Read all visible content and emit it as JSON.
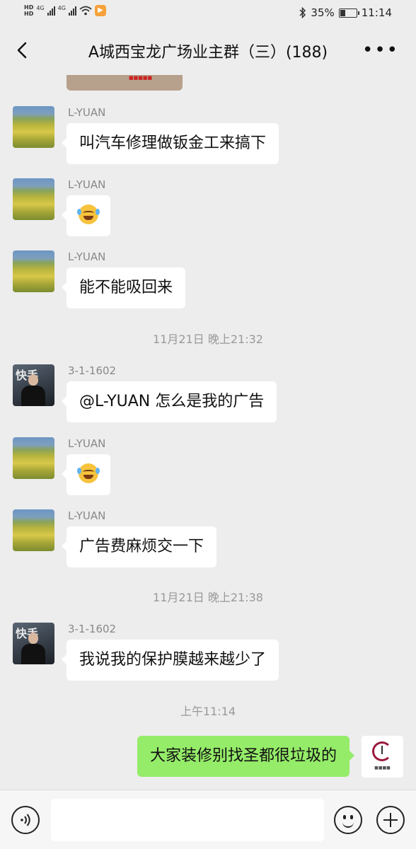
{
  "status_bar": {
    "hd1": "HD",
    "hd2": "HD",
    "net1": "4G",
    "net2": "4G",
    "battery_text": "35%",
    "battery_level": 0.35,
    "time": "11:14"
  },
  "nav": {
    "title": "A城西宝龙广场业主群（三）(188)",
    "more_icon": "more-icon",
    "back_icon": "back-icon"
  },
  "messages": [
    {
      "sender": "L-YUAN",
      "text": "叫汽车修理做钣金工来搞下"
    },
    {
      "sender": "L-YUAN",
      "emoji": "crying-laughing-emoji"
    },
    {
      "sender": "L-YUAN",
      "text": "能不能吸回来"
    },
    {
      "sender": "3-1-1602",
      "text": "@L-YUAN  怎么是我的广告"
    },
    {
      "sender": "L-YUAN",
      "emoji": "crying-laughing-emoji"
    },
    {
      "sender": "L-YUAN",
      "text": "广告费麻烦交一下"
    },
    {
      "sender": "3-1-1602",
      "text": "我说我的保护膜越来越少了"
    }
  ],
  "timestamps": [
    "11月21日 晚上21:32",
    "11月21日 晚上21:38",
    "上午11:14"
  ],
  "self_message": {
    "text": "大家装修别找圣都很垃圾的"
  },
  "colors": {
    "self_bubble": "#95ec69",
    "background": "#ededed",
    "bubble": "#ffffff"
  }
}
